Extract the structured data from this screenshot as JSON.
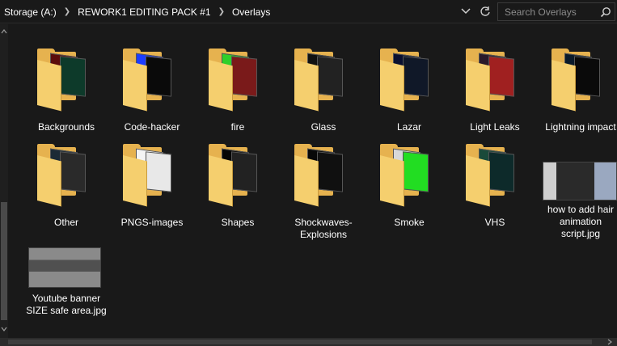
{
  "breadcrumb": {
    "items": [
      "Storage (A:)",
      "REWORK1 EDITING PACK #1",
      "Overlays"
    ],
    "separator": ">"
  },
  "address_buttons": {
    "dropdown_icon": "chevron-down-icon",
    "refresh_icon": "refresh-icon"
  },
  "search": {
    "placeholder": "Search Overlays",
    "icon": "search-icon"
  },
  "folders": [
    {
      "label": "Backgrounds",
      "p1": "#5a0c0c",
      "p2": "#0d3a2a"
    },
    {
      "label": "Code-hacker",
      "p1": "#1c3cff",
      "p2": "#0a0a0a"
    },
    {
      "label": "fire",
      "p1": "#2fcf2a",
      "p2": "#7a1a1a"
    },
    {
      "label": "Glass",
      "p1": "#111111",
      "p2": "#222222"
    },
    {
      "label": "Lazar",
      "p1": "#0a1030",
      "p2": "#101828"
    },
    {
      "label": "Light Leaks",
      "p1": "#2a1a2a",
      "p2": "#a02020"
    },
    {
      "label": "Lightning impact",
      "p1": "#0a1a2a",
      "p2": "#0a0a0a"
    },
    {
      "label": "Other",
      "p1": "#1c2a36",
      "p2": "#2a2a2a"
    },
    {
      "label": "PNGS-images",
      "p1": "#f4f4f4",
      "p2": "#e8e8e8"
    },
    {
      "label": "Shapes",
      "p1": "#050505",
      "p2": "#222222"
    },
    {
      "label": "Shockwaves-Explosions",
      "p1": "#080808",
      "p2": "#101010"
    },
    {
      "label": "Smoke",
      "p1": "#d8d8d8",
      "p2": "#22dd22"
    },
    {
      "label": "VHS",
      "p1": "#1a4a3a",
      "p2": "#0d2a2a"
    }
  ],
  "files": [
    {
      "label": "how to add hair animation script.jpg"
    },
    {
      "label": "Youtube banner SIZE safe area.jpg"
    }
  ],
  "colors": {
    "background": "#191919",
    "folder": "#f5cf6e",
    "folder_back": "#e6b24f",
    "text": "#ffffff"
  }
}
